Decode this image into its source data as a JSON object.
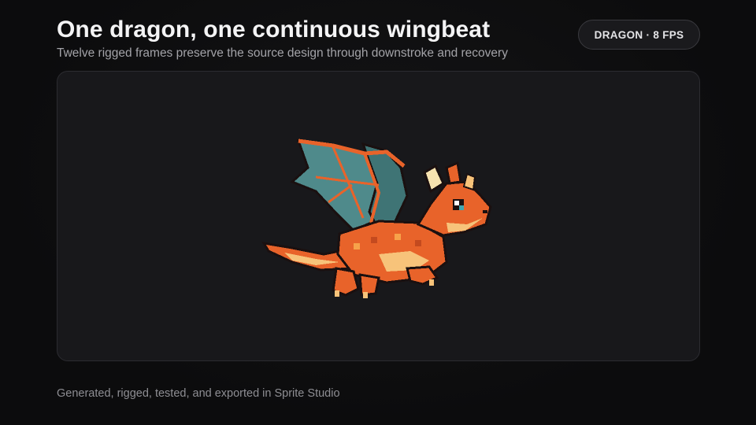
{
  "header": {
    "title": "One dragon, one continuous wingbeat",
    "subtitle": "Twelve rigged frames preserve the source design through downstroke and recovery"
  },
  "badge": {
    "label": "DRAGON · 8 FPS"
  },
  "sprite": {
    "icon": "dragon-sprite-icon"
  },
  "footer": {
    "text": "Generated, rigged, tested, and exported in Sprite Studio"
  },
  "colors": {
    "background": "#0d0d0f",
    "stage": "#18181b",
    "dragon_body": "#e8632a",
    "dragon_wing": "#4f8a8b",
    "dragon_highlight": "#f7c37a"
  }
}
